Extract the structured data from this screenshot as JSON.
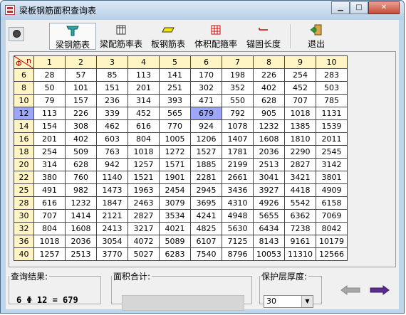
{
  "window": {
    "title": "梁板钢筋面积查询表"
  },
  "window_buttons": {
    "minimize": "▁",
    "maximize": "□",
    "close": "✕"
  },
  "toolbar": {
    "buttons": [
      {
        "label": "梁钢筋表",
        "icon": "teal-t-beam-icon"
      },
      {
        "label": "梁配筋率表",
        "icon": "grid-table-icon"
      },
      {
        "label": "板钢筋表",
        "icon": "yellow-slab-icon"
      },
      {
        "label": "体积配箍率",
        "icon": "red-grid-icon"
      },
      {
        "label": "锚固长度",
        "icon": "red-anchor-line-icon"
      },
      {
        "label": "退出",
        "icon": "exit-door-icon"
      }
    ],
    "active": "梁钢筋表"
  },
  "grid": {
    "corner_left": "Φ",
    "corner_right": "n",
    "columns": [
      "1",
      "2",
      "3",
      "4",
      "5",
      "6",
      "7",
      "8",
      "9",
      "10"
    ],
    "selected_row": "12",
    "selected_col": "6",
    "rows": [
      {
        "d": "6",
        "v": [
          "28",
          "57",
          "85",
          "113",
          "141",
          "170",
          "198",
          "226",
          "254",
          "283"
        ]
      },
      {
        "d": "8",
        "v": [
          "50",
          "101",
          "151",
          "201",
          "251",
          "302",
          "352",
          "402",
          "452",
          "503"
        ]
      },
      {
        "d": "10",
        "v": [
          "79",
          "157",
          "236",
          "314",
          "393",
          "471",
          "550",
          "628",
          "707",
          "785"
        ]
      },
      {
        "d": "12",
        "v": [
          "113",
          "226",
          "339",
          "452",
          "565",
          "679",
          "792",
          "905",
          "1018",
          "1131"
        ]
      },
      {
        "d": "14",
        "v": [
          "154",
          "308",
          "462",
          "616",
          "770",
          "924",
          "1078",
          "1232",
          "1385",
          "1539"
        ]
      },
      {
        "d": "16",
        "v": [
          "201",
          "402",
          "603",
          "804",
          "1005",
          "1206",
          "1407",
          "1608",
          "1810",
          "2011"
        ]
      },
      {
        "d": "18",
        "v": [
          "254",
          "509",
          "763",
          "1018",
          "1272",
          "1527",
          "1781",
          "2036",
          "2290",
          "2545"
        ]
      },
      {
        "d": "20",
        "v": [
          "314",
          "628",
          "942",
          "1257",
          "1571",
          "1885",
          "2199",
          "2513",
          "2827",
          "3142"
        ]
      },
      {
        "d": "22",
        "v": [
          "380",
          "760",
          "1140",
          "1521",
          "1901",
          "2281",
          "2661",
          "3041",
          "3421",
          "3801"
        ]
      },
      {
        "d": "25",
        "v": [
          "491",
          "982",
          "1473",
          "1963",
          "2454",
          "2945",
          "3436",
          "3927",
          "4418",
          "4909"
        ]
      },
      {
        "d": "28",
        "v": [
          "616",
          "1232",
          "1847",
          "2463",
          "3079",
          "3695",
          "4310",
          "4926",
          "5542",
          "6158"
        ]
      },
      {
        "d": "30",
        "v": [
          "707",
          "1414",
          "2121",
          "2827",
          "3534",
          "4241",
          "4948",
          "5655",
          "6362",
          "7069"
        ]
      },
      {
        "d": "32",
        "v": [
          "804",
          "1608",
          "2413",
          "3217",
          "4021",
          "4825",
          "5630",
          "6434",
          "7238",
          "8042"
        ]
      },
      {
        "d": "36",
        "v": [
          "1018",
          "2036",
          "3054",
          "4072",
          "5089",
          "6107",
          "7125",
          "8143",
          "9161",
          "10179"
        ]
      },
      {
        "d": "40",
        "v": [
          "1257",
          "2513",
          "3770",
          "5027",
          "6283",
          "7540",
          "8796",
          "10053",
          "11310",
          "12566"
        ]
      }
    ]
  },
  "result": {
    "label": "查询结果:",
    "value": "6 Φ 12 = 679"
  },
  "area": {
    "label": "面积合计:",
    "value": ""
  },
  "cover": {
    "label": "保护层厚度:",
    "value": "30"
  },
  "colors": {
    "selected": "#9da6f8",
    "header": "#fff5c4",
    "nav_arrow": "#5b2d8e"
  }
}
